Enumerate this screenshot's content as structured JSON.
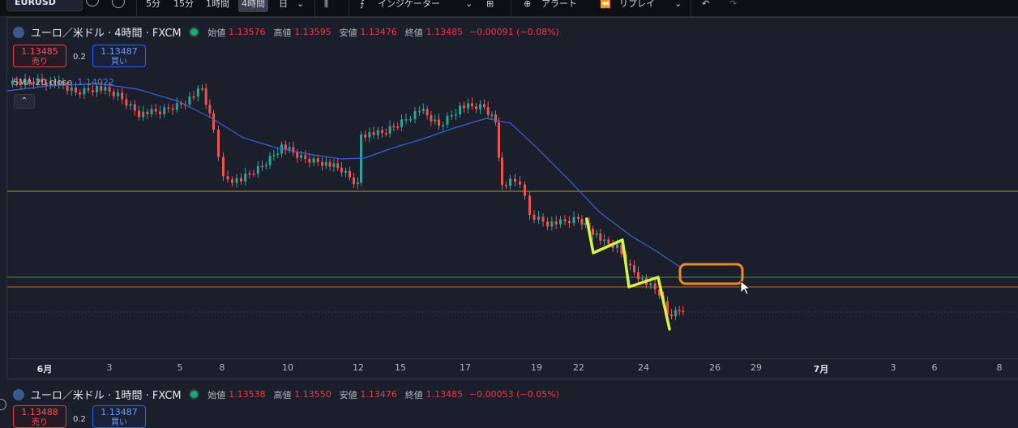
{
  "toolbar": {
    "symbol": "EURUSD",
    "timeframes": [
      "5分",
      "15分",
      "1時間",
      "4時間"
    ],
    "active_timeframe": "4時間",
    "day_label": "日",
    "indicators": "インジケーター",
    "alert": "アラート",
    "replay": "リプレイ"
  },
  "chart1": {
    "title": "ユーロ／米ドル · 4時間 · FXCM",
    "open_label": "始値",
    "open": "1.13576",
    "high_label": "高値",
    "high": "1.13595",
    "low_label": "安値",
    "low": "1.13476",
    "close_label": "終値",
    "close": "1.13485",
    "change": "−0.00091 (−0.08%)",
    "sell_price": "1.13485",
    "sell_label": "売り",
    "spread": "0.2",
    "buy_price": "1.13487",
    "buy_label": "買い",
    "sma_label": "SMA 20 close",
    "sma_value": "1.14022"
  },
  "date_axis": [
    "6月",
    "3",
    "5",
    "8",
    "10",
    "12",
    "15",
    "17",
    "19",
    "22",
    "24",
    "26",
    "29",
    "7月",
    "3",
    "6",
    "8"
  ],
  "chart2": {
    "title": "ユーロ／米ドル · 1時間 · FXCM",
    "open_label": "始値",
    "open": "1.13538",
    "high_label": "高値",
    "high": "1.13550",
    "low_label": "安値",
    "low": "1.13476",
    "close_label": "終値",
    "close": "1.13485",
    "change": "−0.00053 (−0.05%)",
    "sell_price": "1.13488",
    "sell_label": "売り",
    "spread": "0.2",
    "buy_price": "1.13487",
    "buy_label": "買い"
  },
  "colors": {
    "up": "#26a69a",
    "down": "#ef5350",
    "sma": "#3f5fd6",
    "annotation_yellow": "#d4f542",
    "annotation_orange": "#f08a24",
    "hline_yellow": "#a7a23a",
    "hline_green": "#4f8a5a",
    "hline_orange": "#c0662a"
  },
  "icons": [
    "chevron-down-icon",
    "plus-circle-icon",
    "candlestick-icon",
    "indicators-icon",
    "grid-icon",
    "alert-icon",
    "replay-icon",
    "undo-icon",
    "redo-icon",
    "cursor-icon"
  ]
}
